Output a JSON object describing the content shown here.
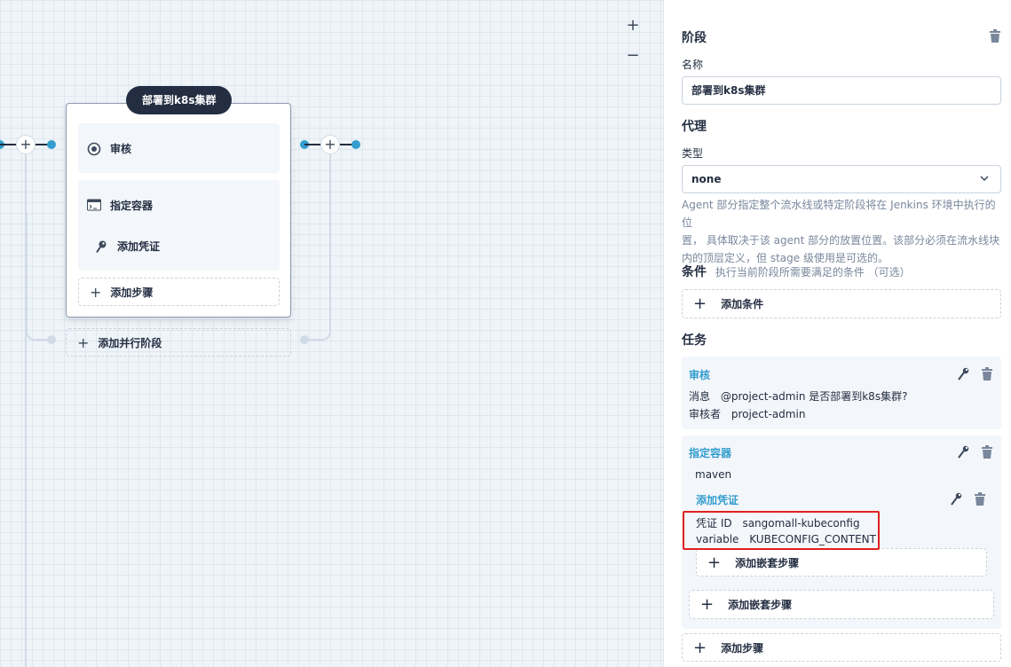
{
  "canvas": {
    "zoom_in": "+",
    "zoom_out": "−",
    "stage": {
      "title": "部署到k8s集群",
      "steps": [
        {
          "label": "审核",
          "icon": "audit-icon"
        },
        {
          "label": "指定容器",
          "icon": "container-icon"
        },
        {
          "label": "添加凭证",
          "icon": "key-icon"
        }
      ],
      "add_step": "添加步骤"
    },
    "add_parallel": "添加并行阶段"
  },
  "panel": {
    "section_stage": "阶段",
    "name_label": "名称",
    "name_value": "部署到k8s集群",
    "section_agent": "代理",
    "type_label": "类型",
    "type_value": "none",
    "agent_desc": "Agent 部分指定整个流水线或特定阶段将在 Jenkins 环境中执行的位置， 具体取决于该 agent 部分的放置位置。该部分必须在流水线块内的顶层定义，但 stage 级使用是可选的。",
    "agent_desc_lines": [
      "Agent 部分指定整个流水线或特定阶段将在 Jenkins 环境中执行的位",
      "置， 具体取决于该 agent 部分的放置位置。该部分必须在流水线块",
      "内的顶层定义，但 stage 级使用是可选的。"
    ],
    "section_condition": "条件",
    "condition_desc": "执行当前阶段所需要满足的条件 （可选）",
    "add_condition": "添加条件",
    "section_tasks": "任务",
    "tasks": {
      "audit": {
        "title": "审核",
        "message_key": "消息",
        "message_value": "@project-admin 是否部署到k8s集群?",
        "reviewer_key": "审核者",
        "reviewer_value": "project-admin"
      },
      "container": {
        "title": "指定容器",
        "value": "maven",
        "credential": {
          "title": "添加凭证",
          "id_key": "凭证 ID",
          "id_value": "sangomall-kubeconfig",
          "var_key": "variable",
          "var_value": "KUBECONFIG_CONTENT",
          "add_nested": "添加嵌套步骤"
        },
        "add_nested": "添加嵌套步骤"
      }
    },
    "add_step": "添加步骤"
  },
  "colors": {
    "accent": "#329dce",
    "dark": "#242e42",
    "highlight": "#e02020"
  }
}
